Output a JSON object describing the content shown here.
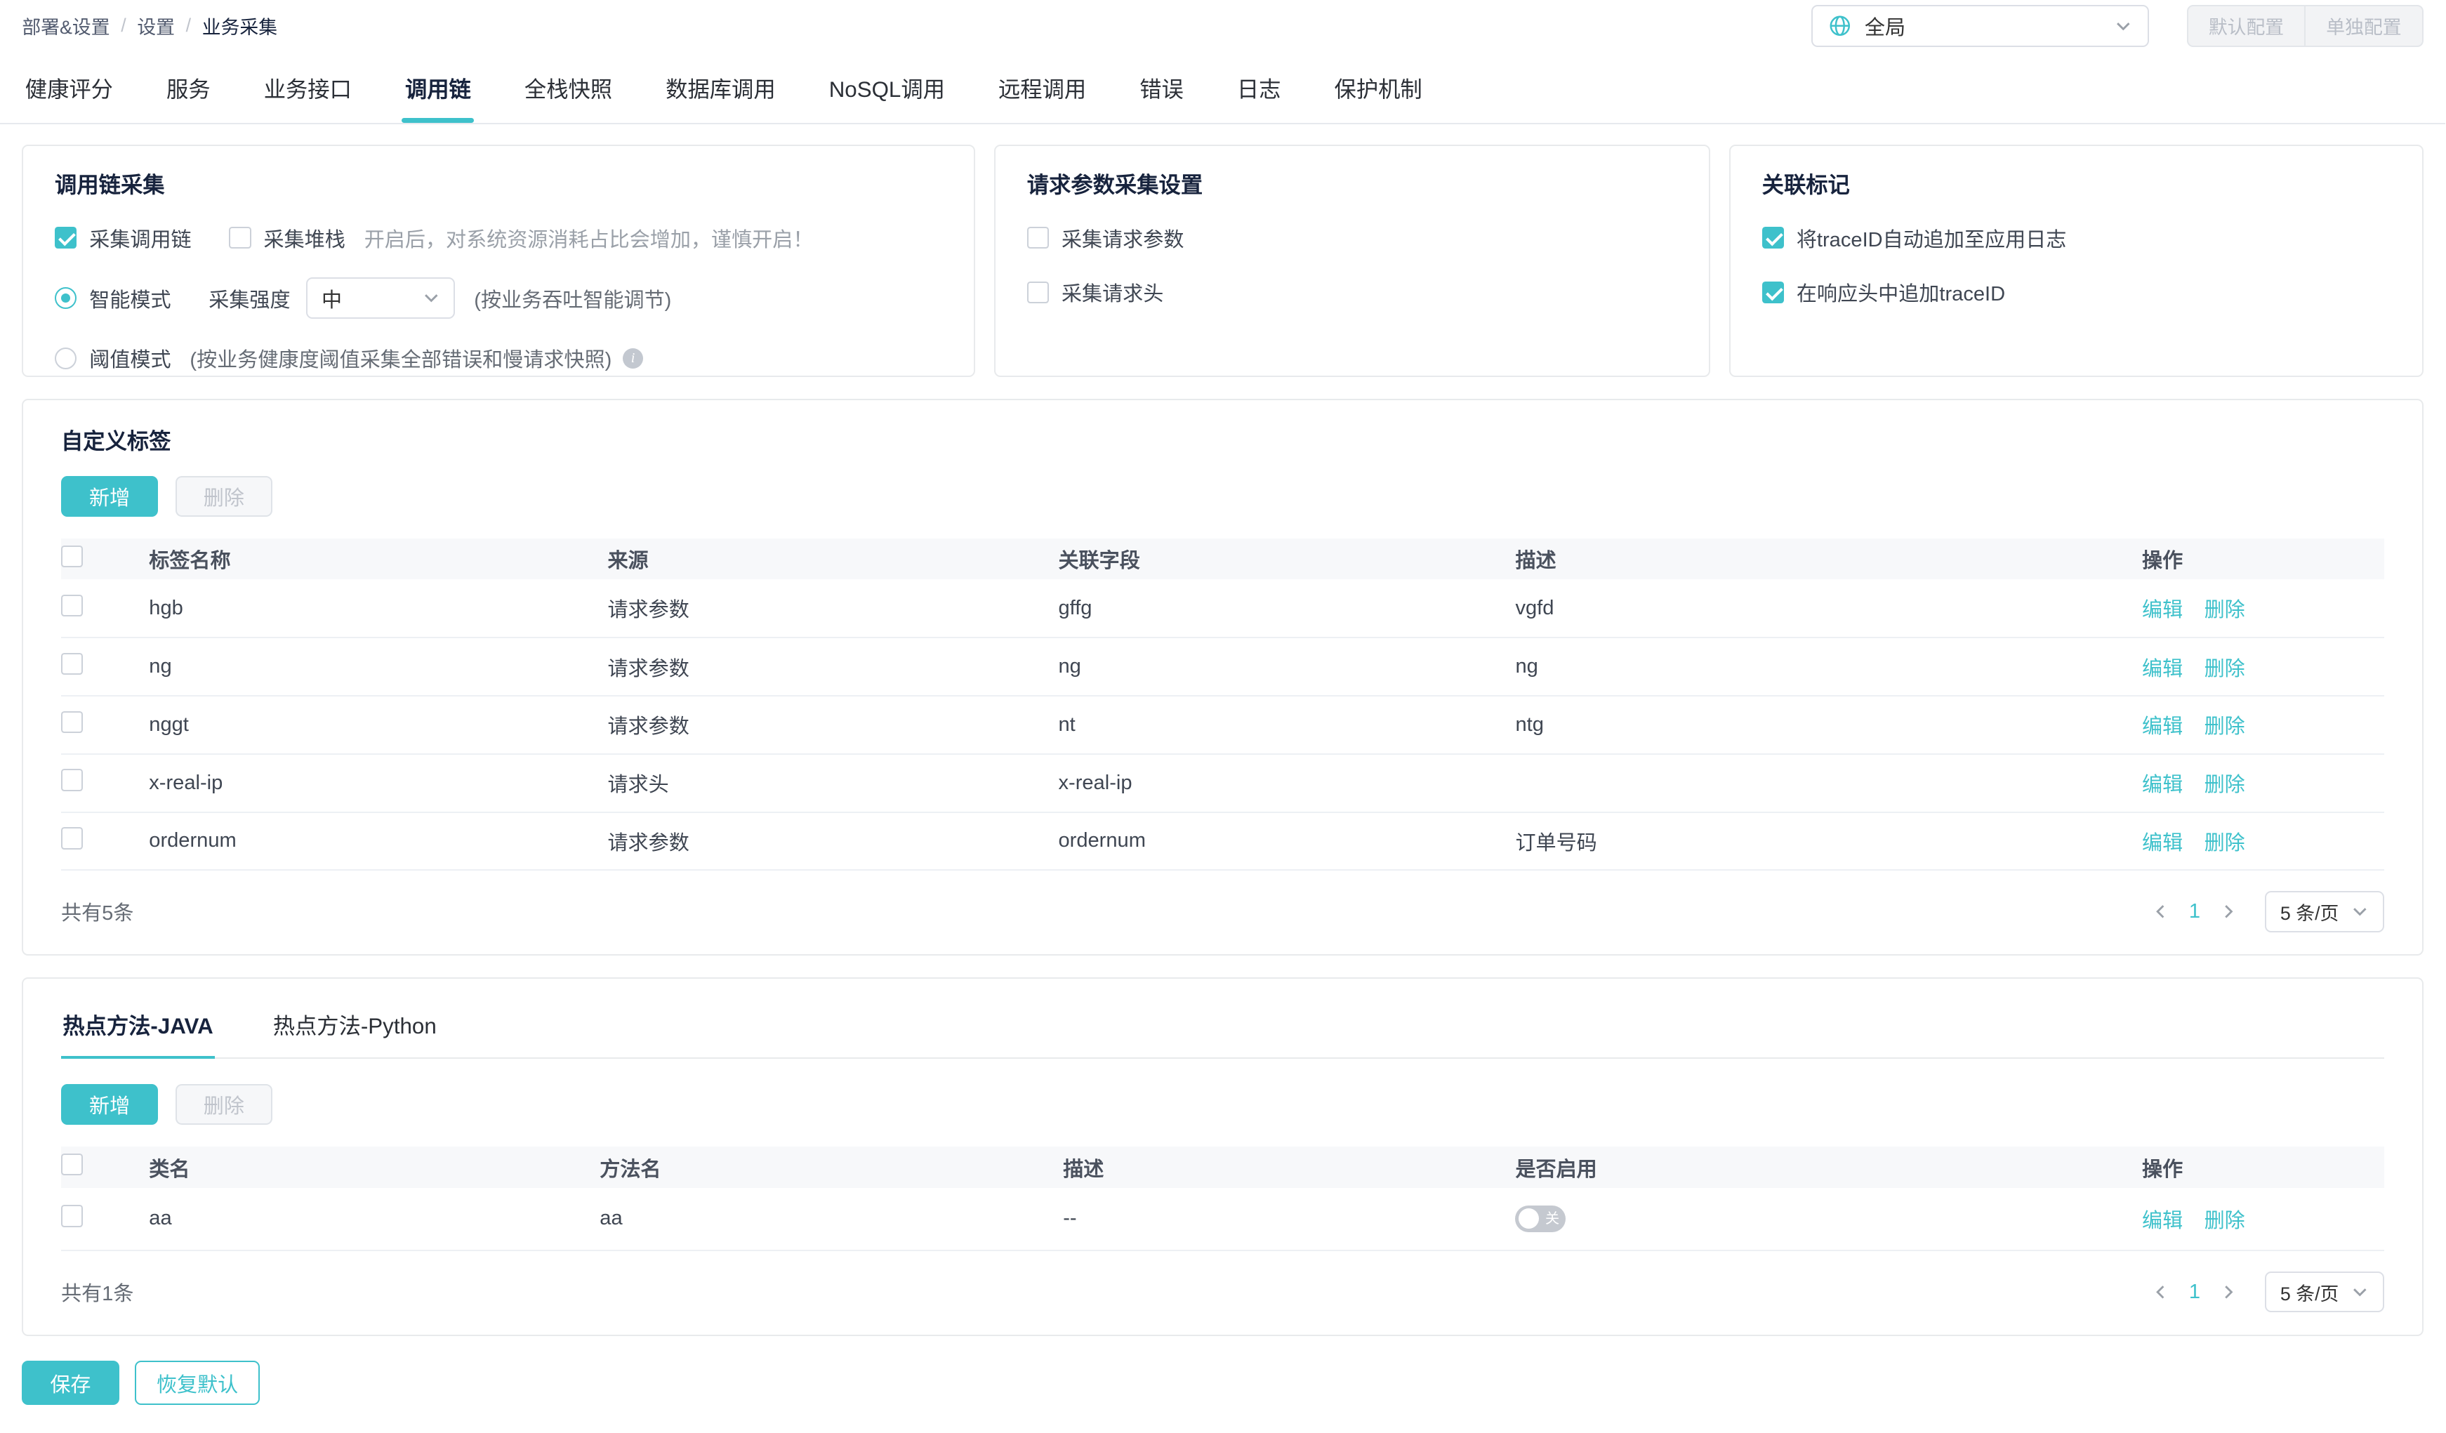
{
  "colors": {
    "accent": "#3EC1CB"
  },
  "breadcrumb": {
    "separator": "/",
    "items": [
      {
        "label": "部署&设置"
      },
      {
        "label": "设置"
      },
      {
        "label": "业务采集"
      }
    ]
  },
  "toolbar": {
    "scope_value": "全局",
    "default_config": "默认配置",
    "single_config": "单独配置"
  },
  "tabs": {
    "active": "调用链",
    "items": [
      {
        "label": "健康评分"
      },
      {
        "label": "服务"
      },
      {
        "label": "业务接口"
      },
      {
        "label": "调用链"
      },
      {
        "label": "全栈快照"
      },
      {
        "label": "数据库调用"
      },
      {
        "label": "NoSQL调用"
      },
      {
        "label": "远程调用"
      },
      {
        "label": "错误"
      },
      {
        "label": "日志"
      },
      {
        "label": "保护机制"
      }
    ]
  },
  "cards": {
    "trace": {
      "title": "调用链采集",
      "collect_trace": "采集调用链",
      "collect_stack": "采集堆栈",
      "stack_hint": "开启后，对系统资源消耗占比会增加，谨慎开启！",
      "smart_mode": "智能模式",
      "intensity_label": "采集强度",
      "intensity_value": "中",
      "smart_hint": "(按业务吞吐智能调节)",
      "threshold_mode": "阈值模式",
      "threshold_hint": "(按业务健康度阈值采集全部错误和慢请求快照)"
    },
    "request": {
      "title": "请求参数采集设置",
      "collect_params": "采集请求参数",
      "collect_headers": "采集请求头"
    },
    "mark": {
      "title": "关联标记",
      "append_to_log": "将traceID自动追加至应用日志",
      "append_to_header": "在响应头中追加traceID"
    }
  },
  "custom_tags": {
    "title": "自定义标签",
    "add_button": "新增",
    "delete_button": "删除",
    "columns": {
      "name": "标签名称",
      "source": "来源",
      "field": "关联字段",
      "desc": "描述",
      "actions": "操作"
    },
    "row_actions": {
      "edit": "编辑",
      "delete": "删除"
    },
    "rows": [
      {
        "name": "hgb",
        "source": "请求参数",
        "field": "gffg",
        "desc": "vgfd"
      },
      {
        "name": "ng",
        "source": "请求参数",
        "field": "ng",
        "desc": "ng"
      },
      {
        "name": "nggt",
        "source": "请求参数",
        "field": "nt",
        "desc": "ntg"
      },
      {
        "name": "x-real-ip",
        "source": "请求头",
        "field": "x-real-ip",
        "desc": ""
      },
      {
        "name": "ordernum",
        "source": "请求参数",
        "field": "ordernum",
        "desc": "订单号码"
      }
    ],
    "footer": {
      "total": "共有5条",
      "page": "1",
      "page_size": "5 条/页"
    }
  },
  "hot_methods": {
    "tabs": [
      {
        "label": "热点方法-JAVA"
      },
      {
        "label": "热点方法-Python"
      }
    ],
    "add_button": "新增",
    "delete_button": "删除",
    "columns": {
      "class_name": "类名",
      "method_name": "方法名",
      "desc": "描述",
      "enabled": "是否启用",
      "actions": "操作"
    },
    "row_actions": {
      "edit": "编辑",
      "delete": "删除"
    },
    "rows": [
      {
        "class_name": "aa",
        "method_name": "aa",
        "desc": "--",
        "switch_label": "关"
      }
    ],
    "footer": {
      "total": "共有1条",
      "page": "1",
      "page_size": "5 条/页"
    }
  },
  "actions": {
    "save": "保存",
    "reset": "恢复默认"
  }
}
